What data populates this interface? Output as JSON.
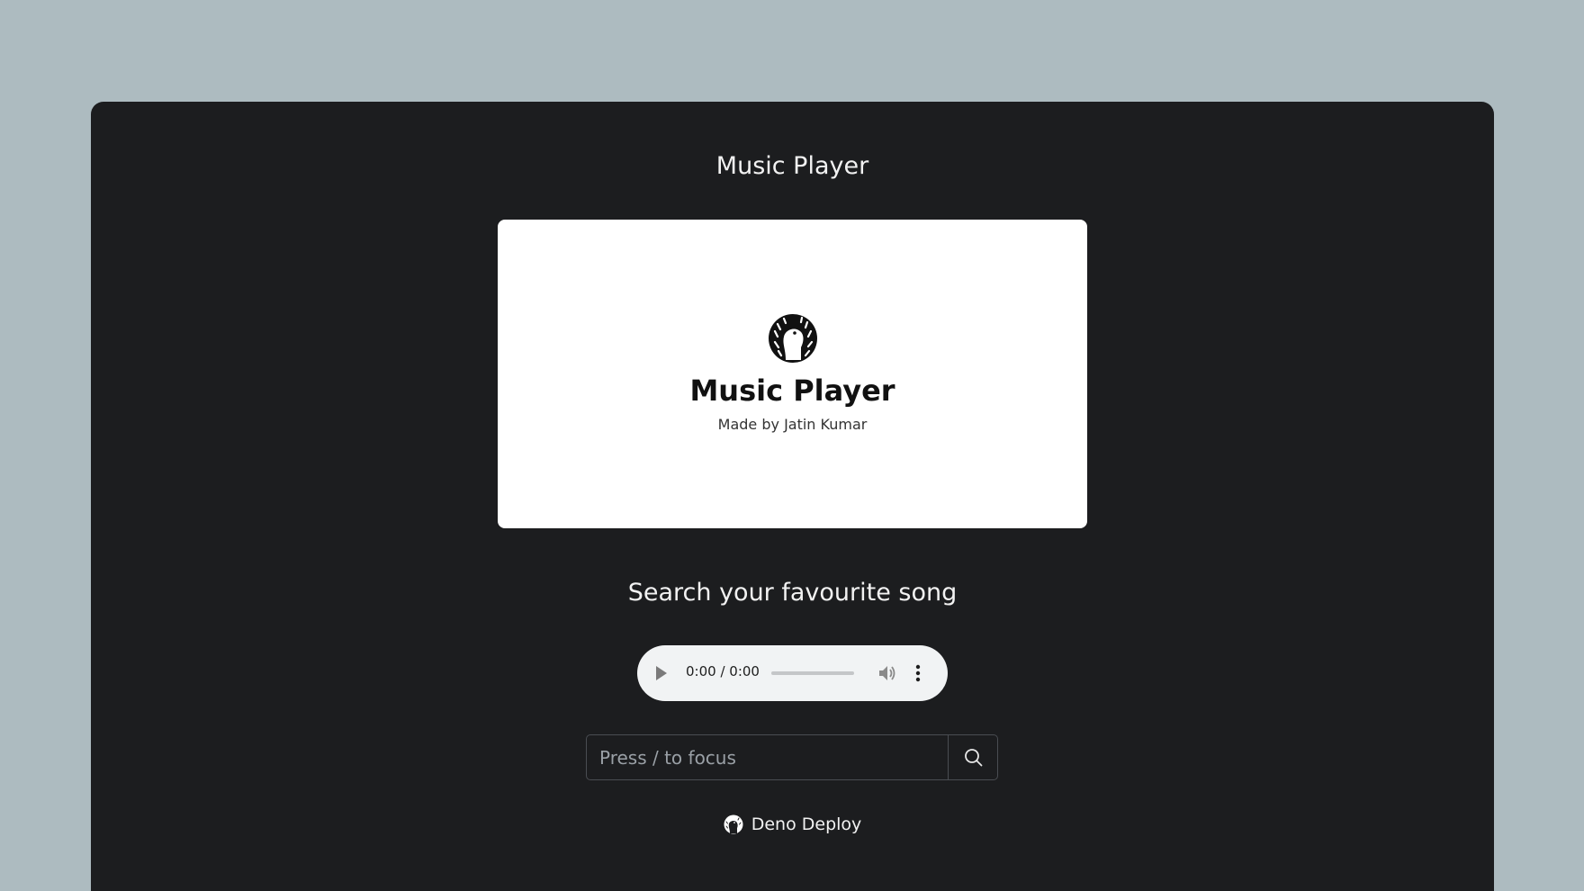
{
  "page": {
    "title": "Music Player"
  },
  "banner": {
    "logo_icon": "deno-dinosaur-icon",
    "title": "Music Player",
    "subtitle": "Made by Jatin Kumar"
  },
  "search": {
    "heading": "Search your favourite song",
    "placeholder": "Press / to focus",
    "button_icon": "search-icon"
  },
  "audio_player": {
    "time": "0:00 / 0:00",
    "progress": 0,
    "play_icon": "play-icon",
    "volume_icon": "volume-icon",
    "menu_icon": "more-vertical-icon"
  },
  "footer": {
    "link_label": "Deno Deploy",
    "logo_icon": "deno-logo-icon"
  },
  "colors": {
    "background": "#adbbc0",
    "window": "#1c1d1f",
    "banner": "#ffffff",
    "player": "#f1f3f4"
  }
}
